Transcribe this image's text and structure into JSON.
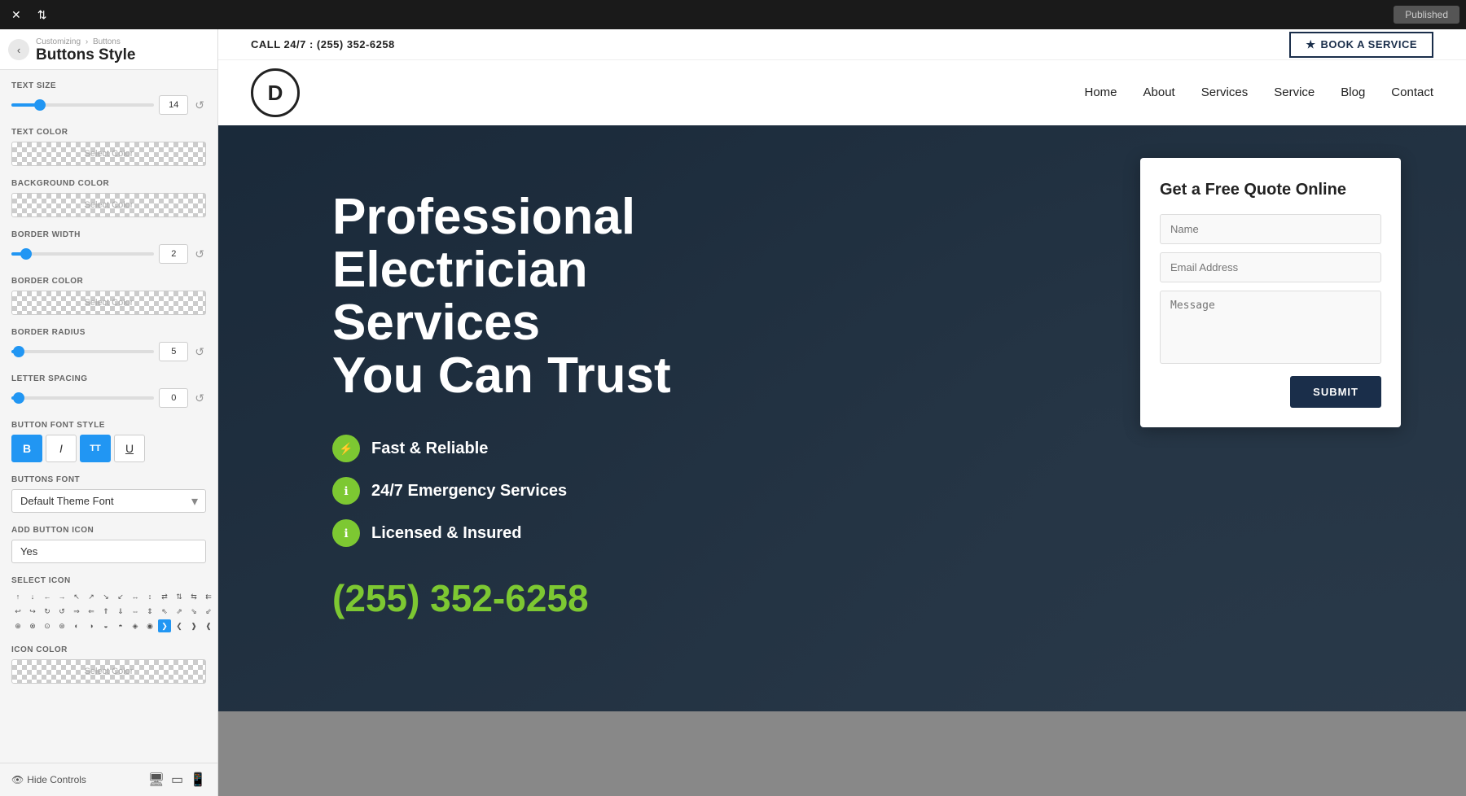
{
  "topbar": {
    "published_label": "Published"
  },
  "panel": {
    "breadcrumb_part1": "Customizing",
    "breadcrumb_sep": "›",
    "breadcrumb_part2": "Buttons",
    "title": "Buttons Style",
    "controls": {
      "text_size_label": "TEXT SIZE",
      "text_size_value": "14",
      "text_size_min_pct": "20",
      "text_color_label": "TEXT COLOR",
      "text_color_placeholder": "Select Color",
      "bg_color_label": "BACKGROUND COLOR",
      "bg_color_placeholder": "Select Color",
      "border_width_label": "BORDER WIDTH",
      "border_width_value": "2",
      "border_width_pct": "10",
      "border_color_label": "BORDER COLOR",
      "border_color_placeholder": "Select Color",
      "border_radius_label": "BORDER RADIUS",
      "border_radius_value": "5",
      "border_radius_pct": "5",
      "letter_spacing_label": "LETTER SPACING",
      "letter_spacing_value": "0",
      "letter_spacing_pct": "5",
      "btn_font_style_label": "BUTTON FONT STYLE",
      "btn_b": "B",
      "btn_i": "I",
      "btn_tt": "TT",
      "btn_u": "U",
      "buttons_font_label": "BUTTONS FONT",
      "buttons_font_value": "Default Theme Font",
      "add_btn_icon_label": "ADD BUTTON ICON",
      "add_btn_icon_value": "Yes",
      "select_icon_label": "SELECT ICON",
      "icon_color_label": "ICON COLOR",
      "icon_color_placeholder": "Select Color"
    },
    "bottom": {
      "hide_controls_label": "Hide Controls"
    }
  },
  "site": {
    "phone_bar": {
      "call_text": "CALL 24/7 : (255) 352-6258",
      "book_icon": "★",
      "book_label": "BOOK A SERVICE"
    },
    "navbar": {
      "logo_letter": "D",
      "nav_links": [
        "Home",
        "About",
        "Services",
        "Service",
        "Blog",
        "Contact"
      ]
    },
    "hero": {
      "title_line1": "Professional",
      "title_line2": "Electrician Services",
      "title_line3": "You Can Trust",
      "features": [
        {
          "icon": "⚡",
          "text": "Fast & Reliable"
        },
        {
          "icon": "ℹ",
          "text": "24/7 Emergency Services"
        },
        {
          "icon": "ℹ",
          "text": "Licensed & Insured"
        }
      ],
      "phone": "(255) 352-6258"
    },
    "quote_form": {
      "title": "Get a Free Quote Online",
      "name_placeholder": "Name",
      "email_placeholder": "Email Address",
      "message_placeholder": "Message",
      "submit_label": "SUBMIT"
    }
  },
  "icons": [
    "↑",
    "↓",
    "←",
    "→",
    "↖",
    "↗",
    "↘",
    "↙",
    "↔",
    "↕",
    "⇄",
    "⇅",
    "⇆",
    "⇇",
    "↩",
    "↪",
    "↻",
    "↺",
    "⇒",
    "⇐",
    "⇑",
    "⇓",
    "⇔",
    "⇕",
    "⇖",
    "⇗",
    "⇘",
    "⇙",
    "⊕",
    "⊗",
    "⊙",
    "⊛",
    "◐",
    "◑",
    "◒",
    "◓",
    "◈",
    "◉",
    "❯",
    "❮",
    "❱",
    "❰"
  ]
}
